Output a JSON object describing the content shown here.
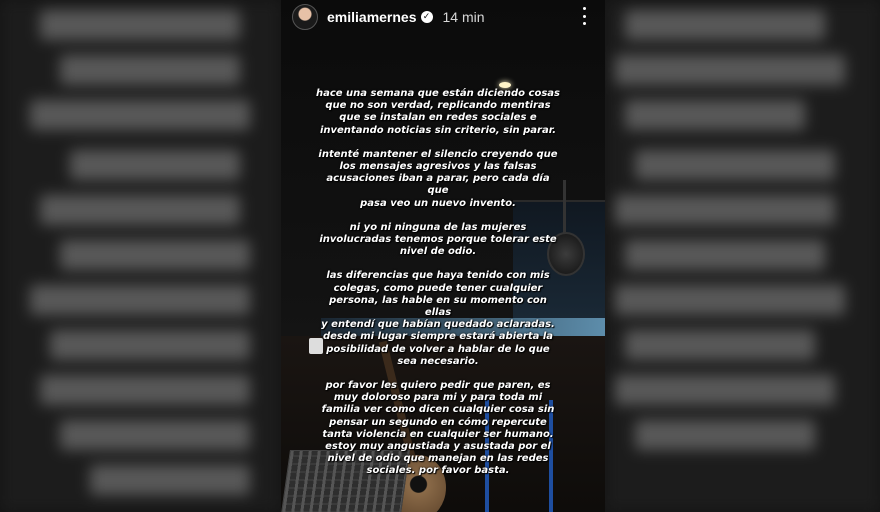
{
  "story": {
    "username": "emiliamernes",
    "verified_icon": "verified-badge-icon",
    "time": "14 min",
    "menu_icon": "more-vertical-icon"
  },
  "message": {
    "p1": "hace una semana que están diciendo cosas\nque no son verdad, replicando mentiras\nque se instalan en redes sociales e\ninventando noticias sin criterio, sin parar.",
    "p2": "intenté mantener el silencio creyendo que\nlos mensajes agresivos y las falsas\nacusaciones iban a parar, pero cada día que\npasa veo un nuevo invento.",
    "p3": "ni yo ni ninguna de las mujeres\ninvolucradas tenemos porque tolerar este\nnivel de odio.",
    "p4": "las diferencias que haya tenido con mis\ncolegas, como puede tener cualquier\npersona, las hable en su momento con ellas\ny entendí que habían quedado aclaradas.\ndesde mi lugar siempre estará abierta la\nposibilidad de volver a hablar de lo que\nsea necesario.",
    "p5": "por favor les quiero pedir que paren, es\nmuy doloroso para mi y para toda mi\nfamilia ver como dicen cualquier cosa sin\npensar un segundo en cómo repercute\ntanta violencia en cualquier ser humano.\nestoy muy angustiada y asustada por el\nnivel de odio que manejan en las redes\nsociales. por favor basta."
  },
  "colors": {
    "text": "#ffffff",
    "background": "#0b0b0b",
    "blurred_side": "#1c1c1c"
  }
}
